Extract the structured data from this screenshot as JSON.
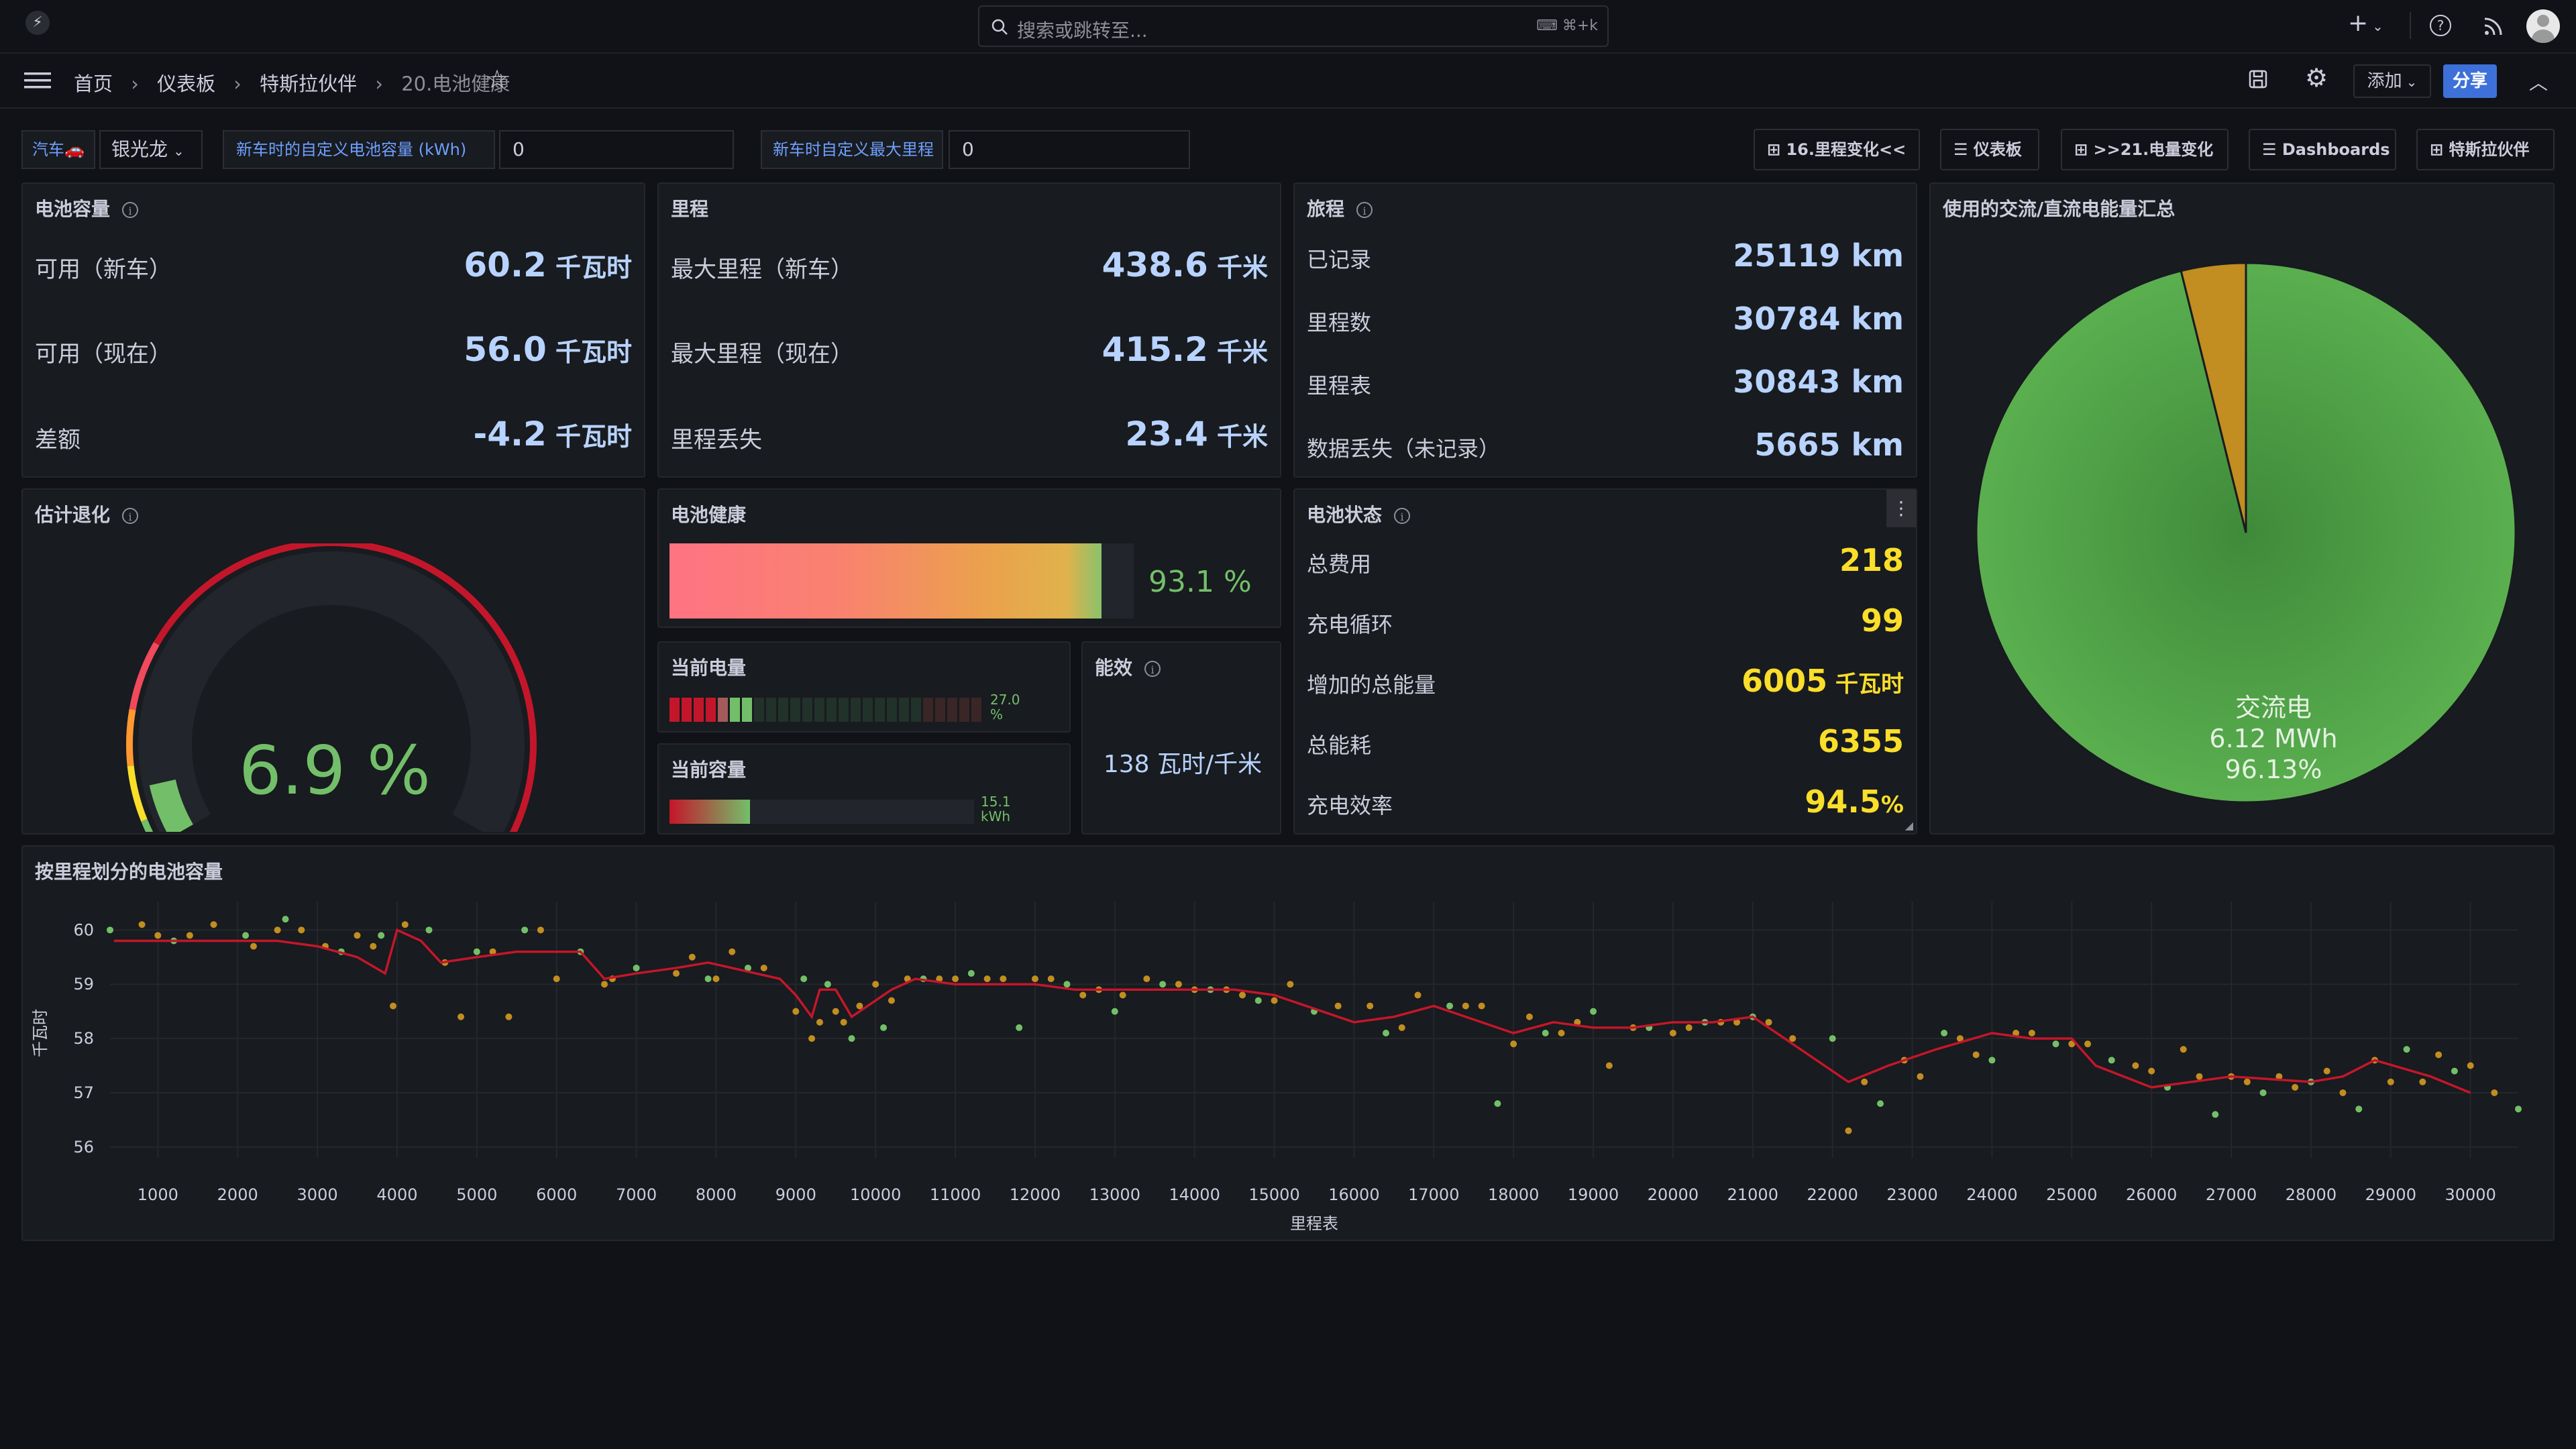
{
  "topbar": {
    "search_placeholder": "搜索或跳转至...",
    "search_shortcut": "⌘+k",
    "plus": "+"
  },
  "breadcrumb": {
    "items": [
      "首页",
      "仪表板",
      "特斯拉伙伴",
      "20.电池健康"
    ]
  },
  "toolbar": {
    "add_label": "添加",
    "share_label": "分享"
  },
  "variables": {
    "car_label": "汽车🚗",
    "car_value": "银光龙",
    "capacity_label": "新车时的自定义电池容量 (kWh)",
    "capacity_value": "0",
    "range_label": "新车时自定义最大里程",
    "range_value": "0"
  },
  "links": [
    "16.里程变化<<",
    "仪表板",
    ">>21.电量变化",
    "Dashboards",
    "特斯拉伙伴"
  ],
  "battery_capacity": {
    "title": "电池容量",
    "rows": [
      {
        "label": "可用（新车）",
        "value": "60.2",
        "unit": " 千瓦时"
      },
      {
        "label": "可用（现在）",
        "value": "56.0",
        "unit": " 千瓦时"
      },
      {
        "label": "差额",
        "value": "-4.2",
        "unit": " 千瓦时"
      }
    ]
  },
  "range": {
    "title": "里程",
    "rows": [
      {
        "label": "最大里程（新车）",
        "value": "438.6",
        "unit": " 千米"
      },
      {
        "label": "最大里程（现在）",
        "value": "415.2",
        "unit": " 千米"
      },
      {
        "label": "里程丢失",
        "value": "23.4",
        "unit": " 千米"
      }
    ]
  },
  "trips": {
    "title": "旅程",
    "rows": [
      {
        "label": "已记录",
        "value": "25119 km"
      },
      {
        "label": "里程数",
        "value": "30784 km"
      },
      {
        "label": "里程表",
        "value": "30843 km"
      },
      {
        "label": "数据丢失（未记录）",
        "value": "5665 km"
      }
    ]
  },
  "degradation": {
    "title": "估计退化",
    "value": "6.9 %",
    "fraction": 0.069,
    "colors": [
      "#73bf69",
      "#fade2a",
      "#ff9830",
      "#f2495c",
      "#c4162a"
    ]
  },
  "battery_health": {
    "title": "电池健康",
    "value": "93.1 %",
    "percent": 93.1
  },
  "current_charge": {
    "title": "当前电量",
    "value": "27.0 %",
    "percent": 27.0
  },
  "current_capacity": {
    "title": "当前容量",
    "value": "15.1 kWh"
  },
  "efficiency": {
    "title": "能效",
    "value": "138 瓦时/千米"
  },
  "battery_status": {
    "title": "电池状态",
    "rows": [
      {
        "label": "总费用",
        "value": "218"
      },
      {
        "label": "充电循环",
        "value": "99"
      },
      {
        "label": "增加的总能量",
        "value": "6005",
        "unit": " 千瓦时"
      },
      {
        "label": "总能耗",
        "value": "6355"
      },
      {
        "label": "充电效率",
        "value": "94.5",
        "unit": "%"
      }
    ]
  },
  "ac_dc": {
    "title": "使用的交流/直流电能量汇总",
    "label": "交流电",
    "value": "6.12 MWh",
    "percent_label": "96.13%",
    "ac_percent": 96.13,
    "colors": {
      "ac": "#56a64b",
      "dc": "#c28d21"
    }
  },
  "chart_data": {
    "type": "line",
    "title": "按里程划分的电池容量",
    "xlabel": "里程表",
    "ylabel": "千瓦时",
    "xlim": [
      400,
      30600
    ],
    "ylim": [
      55.8,
      60.4
    ],
    "xticks": [
      1000,
      2000,
      3000,
      4000,
      5000,
      6000,
      7000,
      8000,
      9000,
      10000,
      11000,
      12000,
      13000,
      14000,
      15000,
      16000,
      17000,
      18000,
      19000,
      20000,
      21000,
      22000,
      23000,
      24000,
      25000,
      26000,
      27000,
      28000,
      29000,
      30000
    ],
    "yticks": [
      56,
      57,
      58,
      59,
      60
    ],
    "series": [
      {
        "type": "line",
        "color": "#c4162a",
        "points": [
          [
            450,
            59.8
          ],
          [
            1000,
            59.8
          ],
          [
            1500,
            59.8
          ],
          [
            2000,
            59.8
          ],
          [
            2500,
            59.8
          ],
          [
            3000,
            59.7
          ],
          [
            3500,
            59.5
          ],
          [
            3850,
            59.2
          ],
          [
            4000,
            60.0
          ],
          [
            4300,
            59.8
          ],
          [
            4550,
            59.4
          ],
          [
            5000,
            59.5
          ],
          [
            5500,
            59.6
          ],
          [
            6000,
            59.6
          ],
          [
            6300,
            59.6
          ],
          [
            6600,
            59.1
          ],
          [
            7000,
            59.2
          ],
          [
            7500,
            59.3
          ],
          [
            7900,
            59.4
          ],
          [
            8200,
            59.3
          ],
          [
            8500,
            59.2
          ],
          [
            8800,
            59.1
          ],
          [
            9000,
            58.8
          ],
          [
            9200,
            58.4
          ],
          [
            9300,
            58.9
          ],
          [
            9500,
            58.9
          ],
          [
            9700,
            58.4
          ],
          [
            9900,
            58.6
          ],
          [
            10200,
            58.9
          ],
          [
            10500,
            59.1
          ],
          [
            11000,
            59.0
          ],
          [
            12000,
            59.0
          ],
          [
            12500,
            58.9
          ],
          [
            13000,
            58.9
          ],
          [
            13500,
            58.9
          ],
          [
            14000,
            58.9
          ],
          [
            14500,
            58.9
          ],
          [
            15000,
            58.8
          ],
          [
            16000,
            58.3
          ],
          [
            16500,
            58.4
          ],
          [
            17000,
            58.6
          ],
          [
            17200,
            58.5
          ],
          [
            18000,
            58.1
          ],
          [
            18500,
            58.3
          ],
          [
            19000,
            58.2
          ],
          [
            19500,
            58.2
          ],
          [
            20000,
            58.3
          ],
          [
            20500,
            58.3
          ],
          [
            21000,
            58.4
          ],
          [
            21500,
            57.9
          ],
          [
            22200,
            57.2
          ],
          [
            22700,
            57.5
          ],
          [
            23300,
            57.8
          ],
          [
            24000,
            58.1
          ],
          [
            24500,
            58.0
          ],
          [
            25000,
            58.0
          ],
          [
            25300,
            57.5
          ],
          [
            26000,
            57.1
          ],
          [
            27000,
            57.3
          ],
          [
            28000,
            57.2
          ],
          [
            28400,
            57.3
          ],
          [
            28800,
            57.6
          ],
          [
            29500,
            57.3
          ],
          [
            30000,
            57.0
          ]
        ]
      },
      {
        "type": "scatter",
        "colors": [
          "#73bf69",
          "#c28d21"
        ],
        "points": [
          [
            400,
            60.0
          ],
          [
            800,
            60.1
          ],
          [
            1000,
            59.9
          ],
          [
            1200,
            59.8
          ],
          [
            1400,
            59.9
          ],
          [
            1700,
            60.1
          ],
          [
            2100,
            59.9
          ],
          [
            2200,
            59.7
          ],
          [
            2500,
            60.0
          ],
          [
            2600,
            60.2
          ],
          [
            2800,
            60.0
          ],
          [
            3100,
            59.7
          ],
          [
            3300,
            59.6
          ],
          [
            3500,
            59.9
          ],
          [
            3700,
            59.7
          ],
          [
            3800,
            59.9
          ],
          [
            3950,
            58.6
          ],
          [
            4100,
            60.1
          ],
          [
            4400,
            60.0
          ],
          [
            4600,
            59.4
          ],
          [
            4800,
            58.4
          ],
          [
            5000,
            59.6
          ],
          [
            5200,
            59.6
          ],
          [
            5400,
            58.4
          ],
          [
            5600,
            60.0
          ],
          [
            5800,
            60.0
          ],
          [
            6000,
            59.1
          ],
          [
            6300,
            59.6
          ],
          [
            6600,
            59.0
          ],
          [
            6700,
            59.1
          ],
          [
            7000,
            59.3
          ],
          [
            7500,
            59.2
          ],
          [
            7700,
            59.5
          ],
          [
            7900,
            59.1
          ],
          [
            8000,
            59.1
          ],
          [
            8200,
            59.6
          ],
          [
            8400,
            59.3
          ],
          [
            8600,
            59.3
          ],
          [
            9000,
            58.5
          ],
          [
            9100,
            59.1
          ],
          [
            9200,
            58.0
          ],
          [
            9300,
            58.3
          ],
          [
            9400,
            59.0
          ],
          [
            9500,
            58.5
          ],
          [
            9600,
            58.3
          ],
          [
            9700,
            58.0
          ],
          [
            9800,
            58.6
          ],
          [
            10000,
            59.0
          ],
          [
            10100,
            58.2
          ],
          [
            10200,
            58.7
          ],
          [
            10400,
            59.1
          ],
          [
            10600,
            59.1
          ],
          [
            10800,
            59.1
          ],
          [
            11000,
            59.1
          ],
          [
            11200,
            59.2
          ],
          [
            11400,
            59.1
          ],
          [
            11600,
            59.1
          ],
          [
            11800,
            58.2
          ],
          [
            12000,
            59.1
          ],
          [
            12200,
            59.1
          ],
          [
            12400,
            59.0
          ],
          [
            12600,
            58.8
          ],
          [
            12800,
            58.9
          ],
          [
            13000,
            58.5
          ],
          [
            13100,
            58.8
          ],
          [
            13400,
            59.1
          ],
          [
            13600,
            59.0
          ],
          [
            13800,
            59.0
          ],
          [
            14000,
            58.9
          ],
          [
            14200,
            58.9
          ],
          [
            14400,
            58.9
          ],
          [
            14600,
            58.8
          ],
          [
            14800,
            58.7
          ],
          [
            15000,
            58.7
          ],
          [
            15200,
            59.0
          ],
          [
            15500,
            58.5
          ],
          [
            15800,
            58.6
          ],
          [
            16200,
            58.6
          ],
          [
            16400,
            58.1
          ],
          [
            16600,
            58.2
          ],
          [
            16800,
            58.8
          ],
          [
            17200,
            58.6
          ],
          [
            17400,
            58.6
          ],
          [
            17600,
            58.6
          ],
          [
            17800,
            56.8
          ],
          [
            18000,
            57.9
          ],
          [
            18200,
            58.4
          ],
          [
            18400,
            58.1
          ],
          [
            18600,
            58.1
          ],
          [
            18800,
            58.3
          ],
          [
            19000,
            58.5
          ],
          [
            19200,
            57.5
          ],
          [
            19500,
            58.2
          ],
          [
            19700,
            58.2
          ],
          [
            20000,
            58.1
          ],
          [
            20200,
            58.2
          ],
          [
            20400,
            58.3
          ],
          [
            20600,
            58.3
          ],
          [
            20800,
            58.3
          ],
          [
            21000,
            58.4
          ],
          [
            21200,
            58.3
          ],
          [
            21500,
            58.0
          ],
          [
            22000,
            58.0
          ],
          [
            22200,
            56.3
          ],
          [
            22400,
            57.2
          ],
          [
            22600,
            56.8
          ],
          [
            22900,
            57.6
          ],
          [
            23100,
            57.3
          ],
          [
            23400,
            58.1
          ],
          [
            23600,
            58.0
          ],
          [
            23800,
            57.7
          ],
          [
            24000,
            57.6
          ],
          [
            24300,
            58.1
          ],
          [
            24500,
            58.1
          ],
          [
            24800,
            57.9
          ],
          [
            25000,
            57.9
          ],
          [
            25200,
            57.9
          ],
          [
            25500,
            57.6
          ],
          [
            25800,
            57.5
          ],
          [
            26000,
            57.4
          ],
          [
            26200,
            57.1
          ],
          [
            26400,
            57.8
          ],
          [
            26600,
            57.3
          ],
          [
            26800,
            56.6
          ],
          [
            27000,
            57.3
          ],
          [
            27200,
            57.2
          ],
          [
            27400,
            57.0
          ],
          [
            27600,
            57.3
          ],
          [
            27800,
            57.1
          ],
          [
            28000,
            57.2
          ],
          [
            28200,
            57.4
          ],
          [
            28400,
            57.0
          ],
          [
            28600,
            56.7
          ],
          [
            28800,
            57.6
          ],
          [
            29000,
            57.2
          ],
          [
            29200,
            57.8
          ],
          [
            29400,
            57.2
          ],
          [
            29600,
            57.7
          ],
          [
            29800,
            57.4
          ],
          [
            30000,
            57.5
          ],
          [
            30300,
            57.0
          ],
          [
            30600,
            56.7
          ]
        ]
      }
    ]
  }
}
